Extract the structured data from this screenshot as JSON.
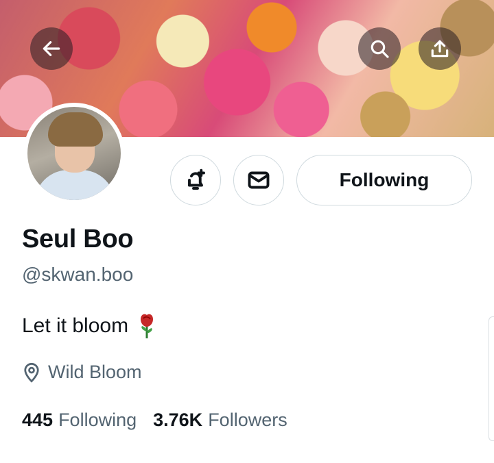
{
  "banner": {
    "back_icon": "arrow-left-icon",
    "search_icon": "search-icon",
    "share_icon": "share-upload-icon"
  },
  "actions": {
    "notify_icon": "bell-plus-icon",
    "message_icon": "mail-icon",
    "follow_label": "Following"
  },
  "profile": {
    "name": "Seul Boo",
    "handle": "@skwan.boo",
    "bio": "Let it bloom",
    "bio_emoji": "rose-emoji",
    "location": "Wild Bloom",
    "following_count": "445",
    "following_label": "Following",
    "followers_count": "3.76K",
    "followers_label": "Followers"
  },
  "colors": {
    "text_primary": "#0f1419",
    "text_secondary": "#536471",
    "border": "#cfd9de"
  }
}
